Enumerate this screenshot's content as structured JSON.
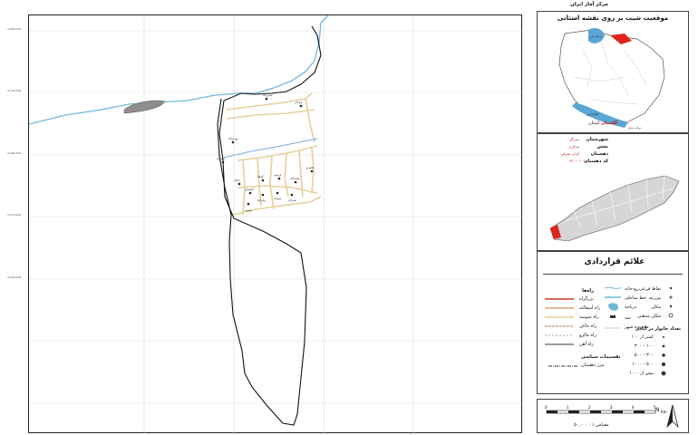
{
  "header": {
    "center_title": "مرکز آمار ایران"
  },
  "map": {
    "village_labels": [
      "باغ‌خان",
      "حسن‌آباد",
      "مهدی‌آباد",
      "علی‌آباد",
      "ده‌آباد",
      "آق‌قلا",
      "قره‌تپه",
      "محمدآباد",
      "قلعه‌نو",
      "گمیشان",
      "ولی‌آباد",
      "سوخته",
      "نصرآباد",
      "چشمه"
    ],
    "coord_labels": [
      "4,200,000",
      "4,190,000",
      "4,180,000",
      "4,170,000",
      "4,160,000"
    ]
  },
  "location_panel": {
    "title": "موقعیت شیت بر روی نقشه استانی",
    "caspian_label": "دریای خزر",
    "gulf_label": "خلیج فارس",
    "oman_label": "دریای عمان",
    "province_caption_prefix": "استان",
    "province_name": "گلستان"
  },
  "admin_info": [
    {
      "label": "شهرستان",
      "value": "بندرگز"
    },
    {
      "label": "بخش",
      "value": "مرکزی"
    },
    {
      "label": "دهستان",
      "value": "انزان شرقی"
    },
    {
      "label": "کد دهستان",
      "value": "۲۷۰۱۰۱۰۰۱"
    }
  ],
  "legend": {
    "title": "علائم قراردادی",
    "roads_title": "راه‌ها",
    "roads": [
      {
        "label": "بزرگراه",
        "color": "#c23b2a"
      },
      {
        "label": "راه آسفالته",
        "color": "#d9a56a"
      },
      {
        "label": "راه شوسه",
        "color": "#e6cf9b"
      },
      {
        "label": "راه خاکی",
        "color": "#b59a76"
      },
      {
        "label": "راه مالرو",
        "color": "#8e8e8e"
      },
      {
        "label": "راه آهن",
        "color": "#333333"
      }
    ],
    "features": [
      {
        "label": "رودخانه",
        "marker": "river"
      },
      {
        "label": "خط ساحلی",
        "marker": "coast"
      },
      {
        "label": "دریاچه",
        "marker": "lake"
      },
      {
        "label": "سد",
        "marker": "dam"
      },
      {
        "label": "محدوده شهر",
        "marker": "city"
      }
    ],
    "points": [
      {
        "label": "نقاط فرعی"
      },
      {
        "label": "مزرعه"
      },
      {
        "label": "مکان"
      },
      {
        "label": "مکان مذهبی"
      }
    ],
    "household_title": "تعداد خانوار در آبادی",
    "households": [
      "کمتر از ۱۰۰",
      "۱۰۰ - ۳۰۰",
      "۳۰۰ - ۵۰۰",
      "۵۰۰ - ۱۰۰۰",
      "بیش از ۱۰۰۰"
    ],
    "political_title": "تقسیمات سیاسی",
    "political": [
      {
        "label": "مرز دهستان"
      }
    ]
  },
  "scale": {
    "caption": "مقیاس ۱ : ۵۰,۰۰۰",
    "ticks": [
      "0",
      "1",
      "2",
      "3",
      "4",
      "5"
    ],
    "unit": "Km",
    "north_label": "N"
  }
}
